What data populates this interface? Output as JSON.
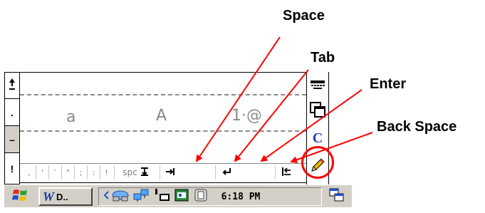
{
  "callouts": {
    "space": "Space",
    "tab": "Tab",
    "enter": "Enter",
    "backspace": "Back Space"
  },
  "colors": {
    "arrow": "#ff0000",
    "taskbar": "#d4d0c8",
    "circle": "#ff0000"
  },
  "left_strip": {
    "icons": [
      "shift-up-arrow-icon",
      "period-icon",
      "dash-icon",
      "exclamation-icon"
    ],
    "period": ".",
    "dash": "–",
    "exclamation": "!"
  },
  "writing_panel": {
    "zones": [
      "a",
      "A",
      "1·@"
    ]
  },
  "punctuation_row": {
    "keys": [
      ",",
      "'",
      "`",
      "\"",
      ";",
      ":",
      "!"
    ],
    "space_label": "spc"
  },
  "right_strip": {
    "icons": [
      "keyboard-icon",
      "window-select-icon",
      "c-letter-icon",
      "pencil-icon"
    ],
    "c_label": "C"
  },
  "taskbar": {
    "start_icon": "windows-flag-icon",
    "task_label": "D..",
    "time": "6:18 PM",
    "tray_icons": [
      "back-arrow-icon",
      "network-icon",
      "network-icon-2",
      "connection-icon",
      "battery-icon",
      "input-panel-icon"
    ],
    "switcher_icon": "window-switcher-icon"
  }
}
